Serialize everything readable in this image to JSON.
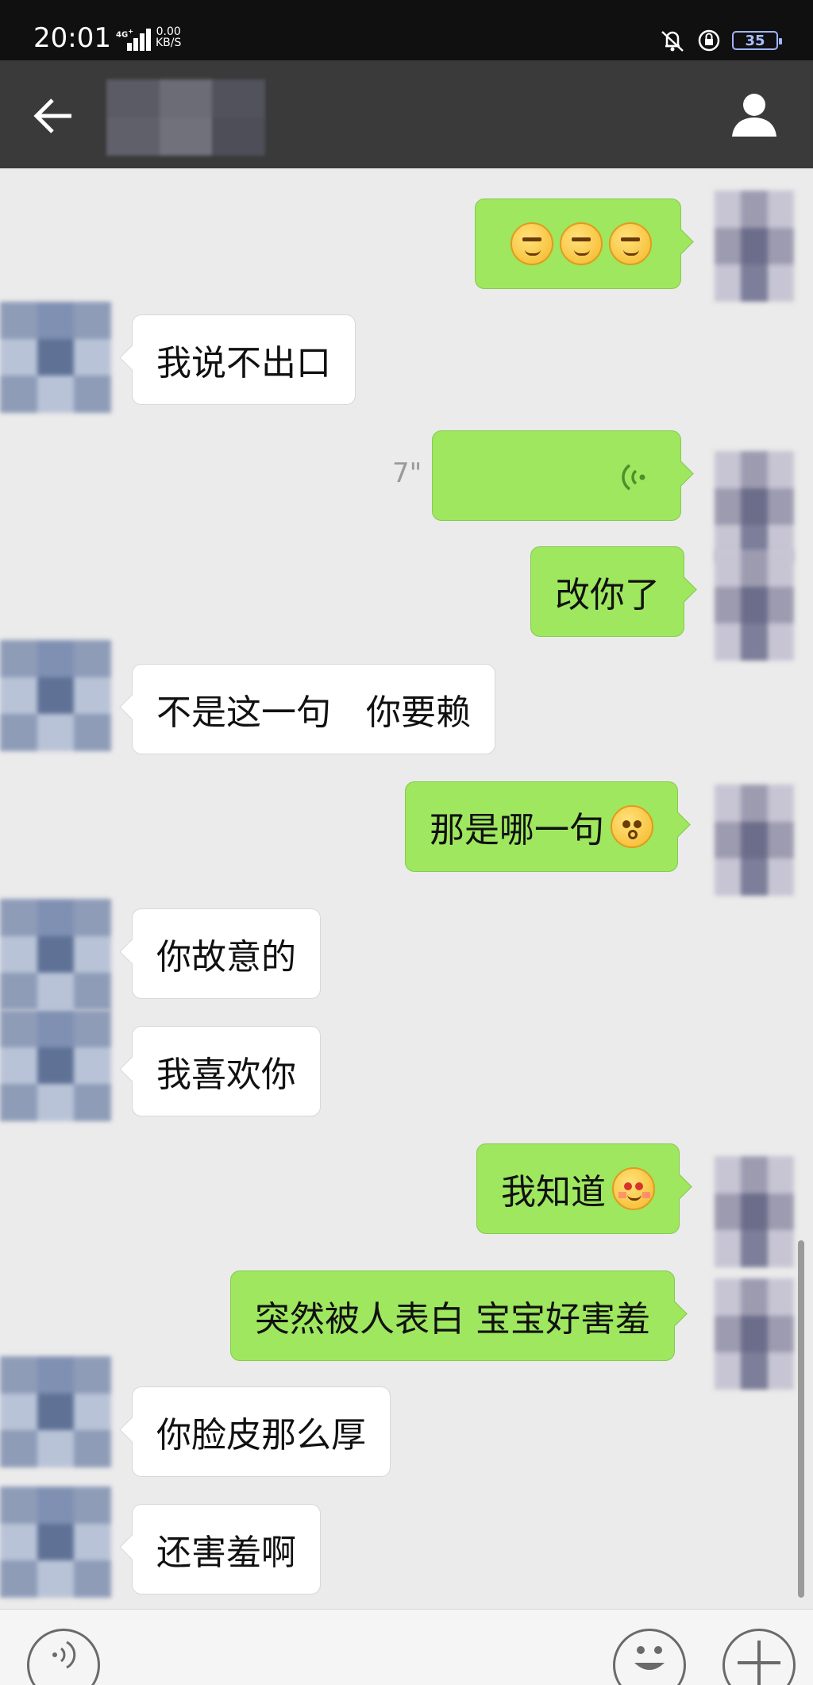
{
  "status_bar": {
    "time": "20:01",
    "network": "4G",
    "speed_value": "0.00",
    "speed_unit": "KB/S",
    "battery": "35"
  },
  "header": {
    "back_icon": "arrow-left-icon",
    "profile_icon": "person-icon"
  },
  "messages": [
    {
      "side": "out",
      "text": "",
      "emoji_count": 3
    },
    {
      "side": "in",
      "text": "我说不出口"
    },
    {
      "side": "out",
      "type": "voice",
      "duration": "7\""
    },
    {
      "side": "out",
      "text": "改你了"
    },
    {
      "side": "in",
      "text": "不是这一句　你要赖"
    },
    {
      "side": "out",
      "text": "那是哪一句",
      "emoji": "shock"
    },
    {
      "side": "in",
      "text": "你故意的"
    },
    {
      "side": "in",
      "text": "我喜欢你"
    },
    {
      "side": "out",
      "text": "我知道",
      "emoji": "shy"
    },
    {
      "side": "out",
      "text": "突然被人表白  宝宝好害羞"
    },
    {
      "side": "in",
      "text": "你脸皮那么厚"
    },
    {
      "side": "in",
      "text": "还害羞啊"
    }
  ],
  "colors": {
    "outgoing_bubble": "#9ee75f",
    "incoming_bubble": "#ffffff",
    "background": "#ebebeb",
    "titlebar": "#3a3a3a"
  }
}
